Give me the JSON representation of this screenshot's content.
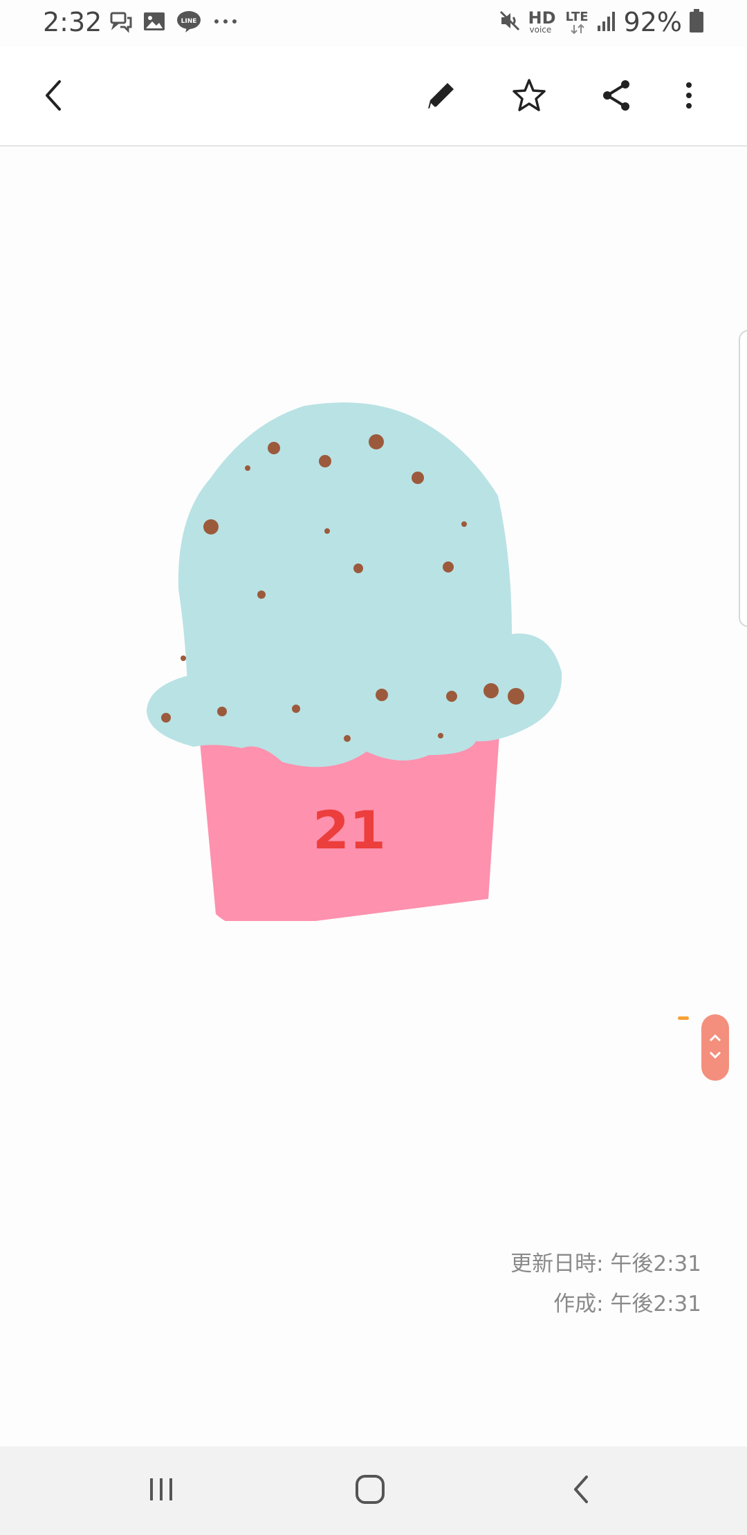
{
  "status_bar": {
    "time": "2:32",
    "hd_label": "HD",
    "voice_label": "voice",
    "lte_label": "LTE",
    "battery": "92%",
    "left_icons": [
      "chat-bubbles-icon",
      "gallery-icon",
      "line-app-icon",
      "more-dots-icon"
    ],
    "right_icons": [
      "mute-icon",
      "signal-icon",
      "battery-icon"
    ]
  },
  "toolbar": {
    "back_icon": "back-arrow-icon",
    "edit_icon": "pencil-icon",
    "favorite_icon": "star-icon",
    "share_icon": "share-icon",
    "more_icon": "more-vertical-icon"
  },
  "note": {
    "drawing": {
      "subject": "cupcake",
      "frosting_color": "#b9e2e4",
      "cup_color": "#fe91ae",
      "sprinkle_color": "#9c5a3c",
      "text_color": "#ec3e3c",
      "text": "21"
    },
    "updated": "更新日時: 午後2:31",
    "created": "作成: 午後2:31"
  },
  "page_scroller": {
    "up_icon": "chevron-up-icon",
    "down_icon": "chevron-down-icon",
    "color": "#f48f7d"
  },
  "scroll_top_icon": "scroll-to-top-icon",
  "nav_bar": {
    "recents_icon": "recents-icon",
    "home_icon": "home-icon",
    "back_icon": "back-icon"
  }
}
